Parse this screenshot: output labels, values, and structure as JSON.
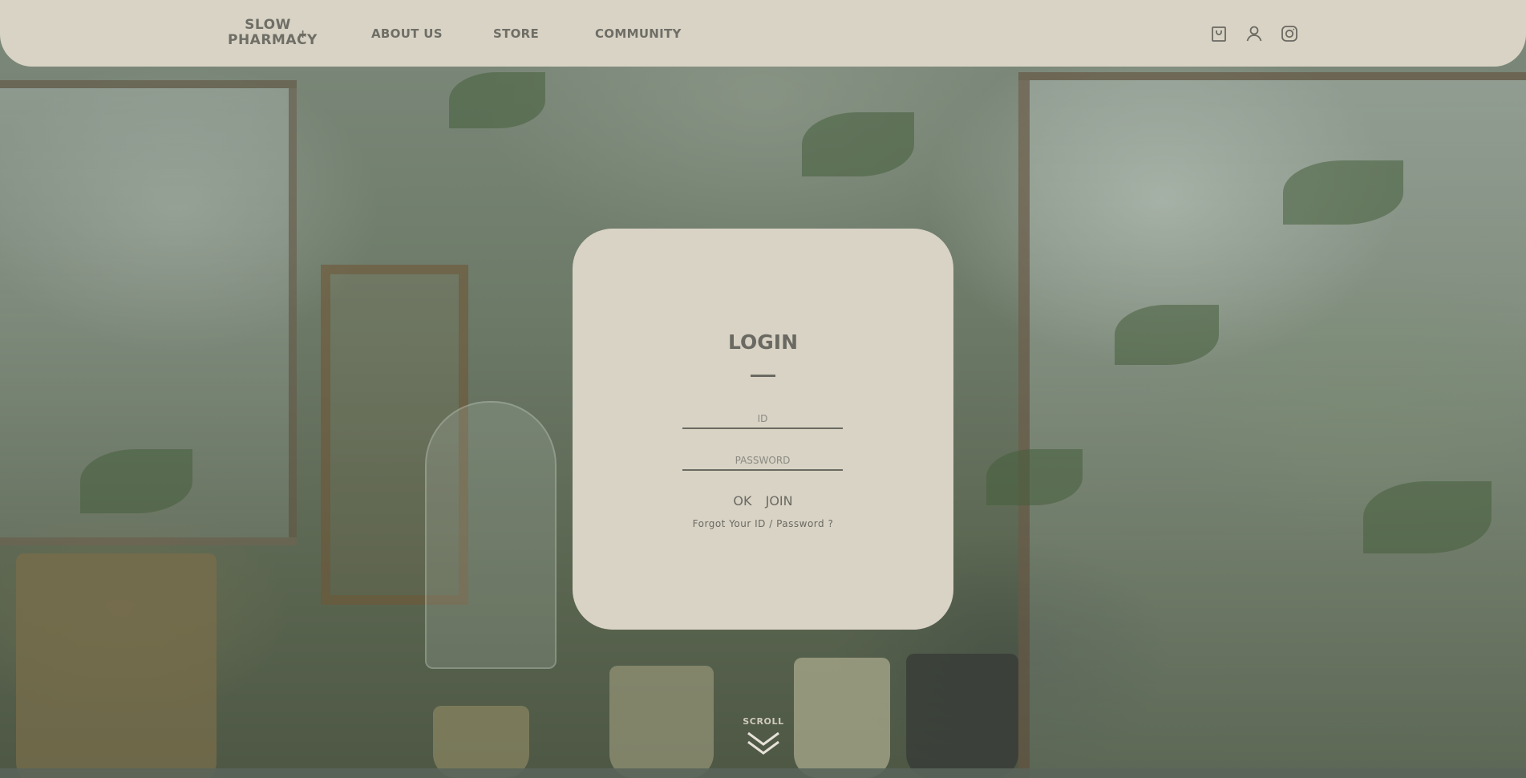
{
  "header": {
    "logo": {
      "line1": "SLOW",
      "line2": "PHARMACY",
      "mark": "+"
    },
    "nav": [
      {
        "label": "ABOUT US"
      },
      {
        "label": "STORE"
      },
      {
        "label": "COMMUNITY"
      }
    ],
    "icons": [
      "shopping-bag-icon",
      "user-icon",
      "instagram-icon"
    ]
  },
  "login": {
    "title": "LOGIN",
    "id_placeholder": "ID",
    "password_placeholder": "PASSWORD",
    "ok_label": "OK",
    "join_label": "JOIN",
    "forgot_label": "Forgot Your ID / Password ?"
  },
  "scroll": {
    "label": "SCROLL"
  },
  "colors": {
    "panel": "#d9d3c5",
    "text": "#6a6a62"
  }
}
